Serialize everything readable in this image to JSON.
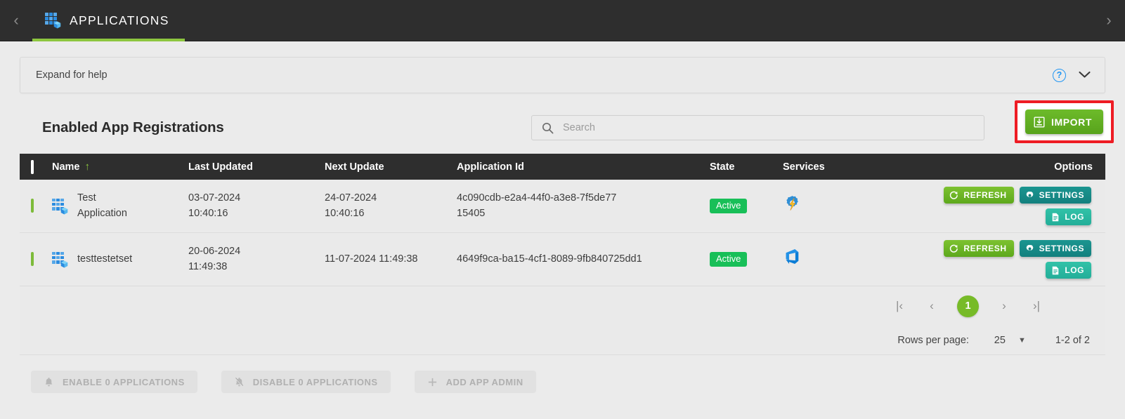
{
  "topbar": {
    "back_arrow": "‹",
    "forward_arrow": "›",
    "tab_label": "APPLICATIONS",
    "tab_icon": "applications-grid-icon",
    "active_underline_color": "#8dc63f",
    "background_color": "#2e2e2e"
  },
  "help": {
    "text": "Expand for help",
    "help_icon": "question-circle-icon",
    "expand_icon": "chevron-down-icon"
  },
  "toolbar": {
    "section_title": "Enabled App Registrations",
    "search_placeholder": "Search",
    "search_value": "",
    "search_icon": "search-icon",
    "import_label": "IMPORT",
    "import_icon": "import-download-icon",
    "import_color": "#5fae22",
    "highlight_box_color": "#ee1c24"
  },
  "table": {
    "columns": [
      {
        "key": "check",
        "label": ""
      },
      {
        "key": "name",
        "label": "Name",
        "sort": "↑"
      },
      {
        "key": "last_updated",
        "label": "Last Updated"
      },
      {
        "key": "next_update",
        "label": "Next Update"
      },
      {
        "key": "application_id",
        "label": "Application Id"
      },
      {
        "key": "state",
        "label": "State"
      },
      {
        "key": "services",
        "label": "Services"
      },
      {
        "key": "options",
        "label": "Options"
      }
    ],
    "rows": [
      {
        "name": "Test Application",
        "last_updated": "03-07-2024 10:40:16",
        "next_update": "24-07-2024 10:40:16",
        "application_id": "4c090cdb-e2a4-44f0-a3e8-7f5de7715405",
        "state": "Active",
        "service_icon": "logic-apps-gear-bolt-icon",
        "checked": false
      },
      {
        "name": "testtestetset",
        "last_updated": "20-06-2024 11:49:38",
        "next_update": "11-07-2024 11:49:38",
        "application_id": "4649f9ca-ba15-4cf1-8089-9fb840725dd1",
        "state": "Active",
        "service_icon": "azure-devops-icon",
        "checked": false
      }
    ],
    "row_actions": {
      "refresh_label": "REFRESH",
      "settings_label": "SETTINGS",
      "log_label": "LOG",
      "refresh_icon": "refresh-icon",
      "settings_icon": "gear-icon",
      "log_icon": "document-icon"
    },
    "state_badge_color": "#18bf58"
  },
  "pagination": {
    "first_label": "|‹",
    "prev_label": "‹",
    "current_page": "1",
    "next_label": "›",
    "last_label": "›|",
    "rows_per_page_label": "Rows per page:",
    "rows_per_page_value": "25",
    "rows_per_page_caret": "▼",
    "range_label": "1-2 of 2",
    "current_page_color": "#77bb28"
  },
  "bottom_actions": [
    {
      "label": "ENABLE 0 APPLICATIONS",
      "icon": "bell-icon",
      "disabled": true
    },
    {
      "label": "DISABLE 0 APPLICATIONS",
      "icon": "bell-off-icon",
      "disabled": true
    },
    {
      "label": "ADD APP ADMIN",
      "icon": "plus-icon",
      "disabled": true
    }
  ]
}
